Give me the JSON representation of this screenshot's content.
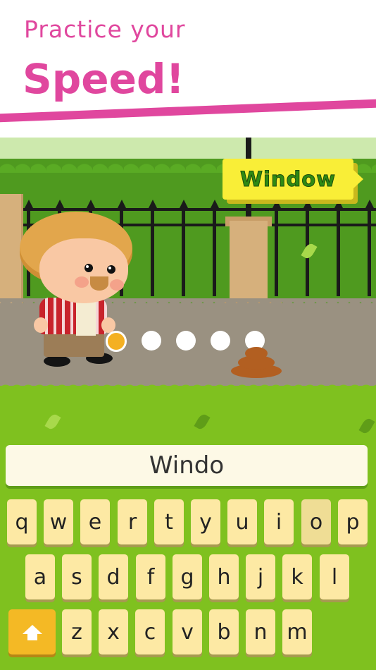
{
  "header": {
    "subtitle": "Practice your",
    "title": "Speed!"
  },
  "game": {
    "target_word": "Window",
    "progress": {
      "total": 5,
      "current": 1
    }
  },
  "input": {
    "value": "Windo"
  },
  "keyboard": {
    "row1": [
      "q",
      "w",
      "e",
      "r",
      "t",
      "y",
      "u",
      "i",
      "o",
      "p"
    ],
    "row2": [
      "a",
      "s",
      "d",
      "f",
      "g",
      "h",
      "j",
      "k",
      "l"
    ],
    "row3": [
      "z",
      "x",
      "c",
      "v",
      "b",
      "n",
      "m"
    ],
    "shift_icon": "shift-arrow-icon",
    "pressed_key": "o"
  },
  "colors": {
    "accent_pink": "#e0479e",
    "sign_yellow": "#f9ee37",
    "sign_text_green": "#2f8a14",
    "grass": "#7fc11f",
    "key_fill": "#fde9a4",
    "shift_fill": "#f4b925",
    "progress_active": "#f4b022"
  }
}
